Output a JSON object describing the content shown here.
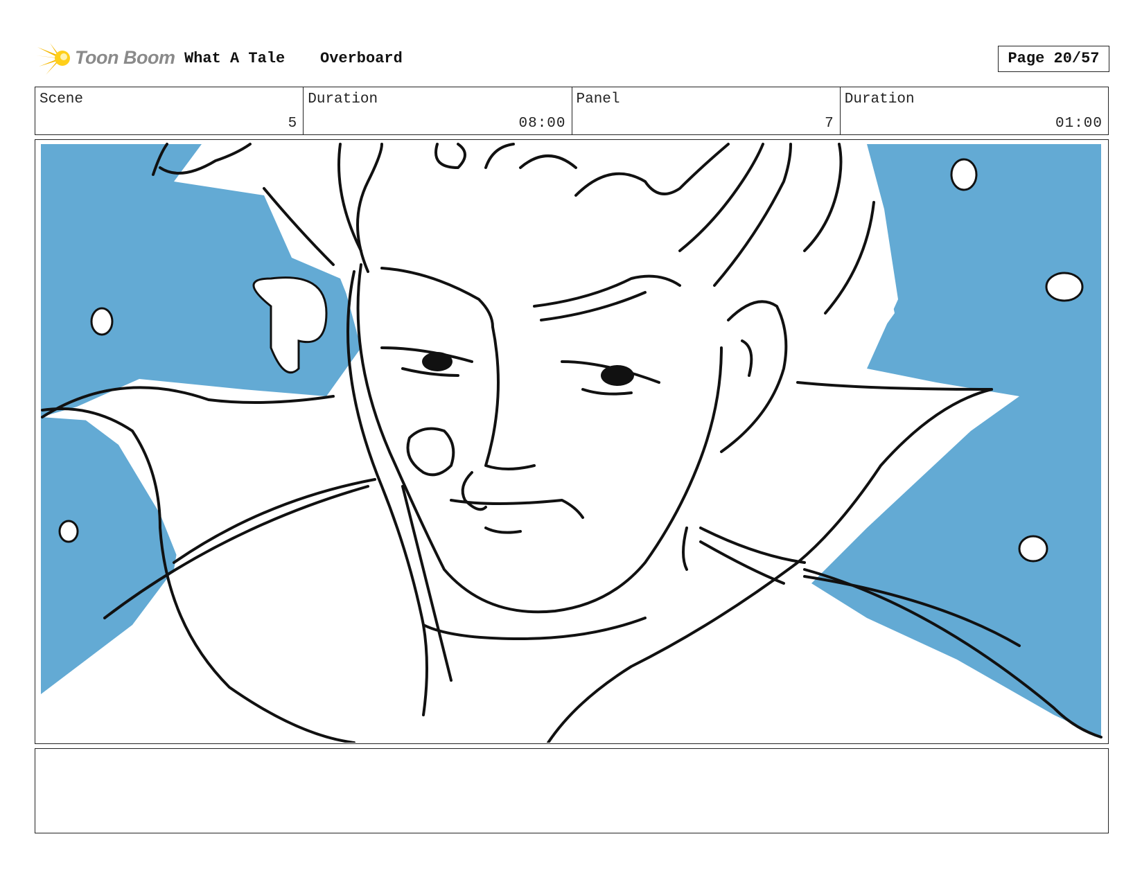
{
  "header": {
    "logo_text": "Toon Boom",
    "logo_icon": "sunburst-logo-icon",
    "project_title": "What A Tale",
    "project_subtitle": "Overboard",
    "page_label": "Page 20/57"
  },
  "info": {
    "scene_label": "Scene",
    "scene_value": "5",
    "scene_duration_label": "Duration",
    "scene_duration_value": "08:00",
    "panel_label": "Panel",
    "panel_value": "7",
    "panel_duration_label": "Duration",
    "panel_duration_value": "01:00"
  },
  "frame": {
    "image": "storyboard-sketch-character-closeup",
    "background_color": "#63aad4",
    "line_color": "#111111"
  },
  "notes": {
    "text": ""
  }
}
